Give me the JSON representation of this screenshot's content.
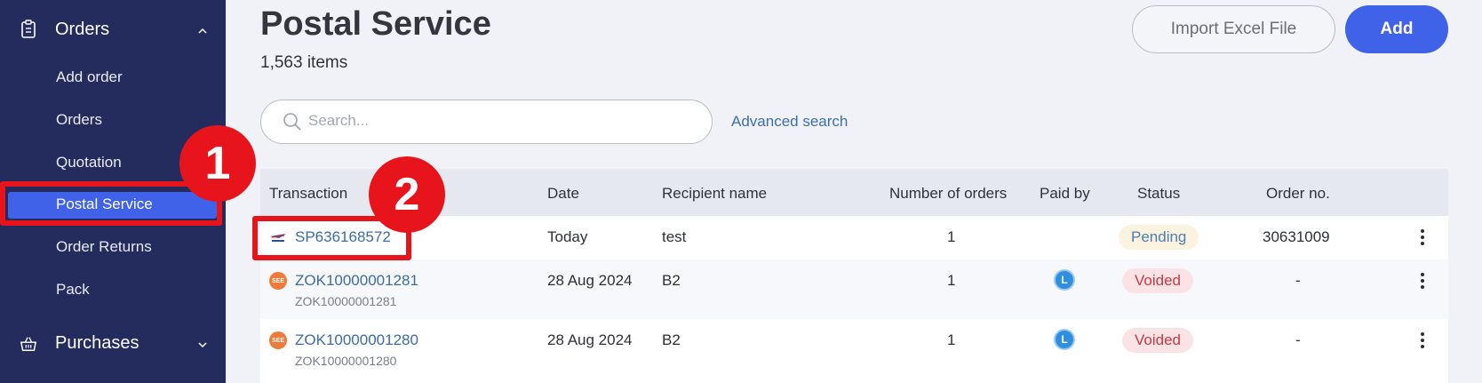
{
  "sidebar": {
    "orders_group": {
      "label": "Orders",
      "icon": "clipboard-icon"
    },
    "items": [
      {
        "label": "Add order"
      },
      {
        "label": "Orders"
      },
      {
        "label": "Quotation"
      },
      {
        "label": "Postal Service",
        "active": true
      },
      {
        "label": "Order Returns"
      },
      {
        "label": "Pack"
      }
    ],
    "purchases_group": {
      "label": "Purchases",
      "icon": "basket-icon"
    }
  },
  "header": {
    "title": "Postal Service",
    "count": "1,563 items",
    "import_label": "Import Excel File",
    "add_label": "Add"
  },
  "search": {
    "placeholder": "Search...",
    "advanced_label": "Advanced search"
  },
  "table": {
    "columns": [
      "Transaction",
      "Date",
      "Recipient name",
      "Number of orders",
      "Paid by",
      "Status",
      "Order no."
    ],
    "rows": [
      {
        "transaction": "SP636168572",
        "sub": "",
        "date": "Today",
        "recipient": "test",
        "orders": "1",
        "paid_by": "",
        "status": "Pending",
        "order_no": "30631009",
        "courier_icon": "postal-courier-icon"
      },
      {
        "transaction": "ZOK10000001281",
        "sub": "ZOK10000001281",
        "date": "28 Aug 2024",
        "recipient": "B2",
        "orders": "1",
        "paid_by": "L",
        "status": "Voided",
        "order_no": "-",
        "courier_icon": "courier-logo-icon"
      },
      {
        "transaction": "ZOK10000001280",
        "sub": "ZOK10000001280",
        "date": "28 Aug 2024",
        "recipient": "B2",
        "orders": "1",
        "paid_by": "L",
        "status": "Voided",
        "order_no": "-",
        "courier_icon": "courier-logo-icon"
      }
    ]
  },
  "annotations": {
    "marker1": "1",
    "marker2": "2"
  },
  "colors": {
    "sidebar": "#242c5e",
    "accent": "#4062e8",
    "highlight": "#e8141b"
  }
}
